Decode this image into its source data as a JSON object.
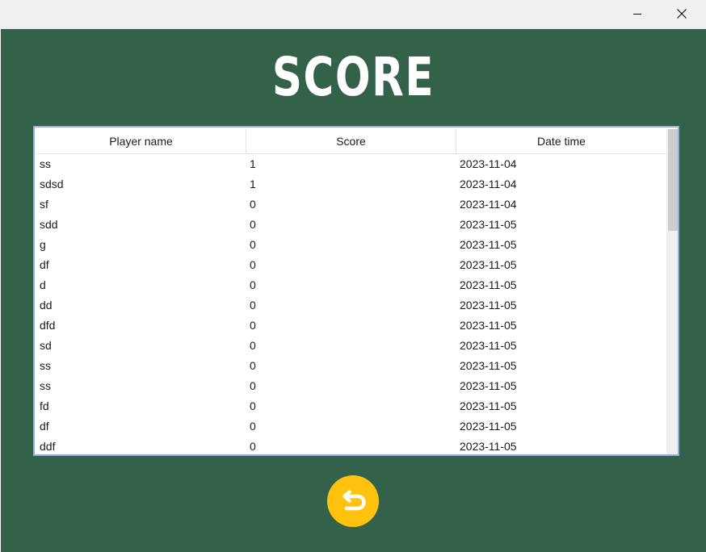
{
  "window": {
    "minimize_icon": "minimize-icon",
    "close_icon": "close-icon"
  },
  "page": {
    "title": "SCORE",
    "background_color": "#33614a",
    "accent_color": "#ffc20e"
  },
  "table": {
    "columns": [
      "Player name",
      "Score",
      "Date time"
    ],
    "rows": [
      [
        "ss",
        "1",
        "2023-11-04"
      ],
      [
        "sdsd",
        "1",
        "2023-11-04"
      ],
      [
        "sf",
        "0",
        "2023-11-04"
      ],
      [
        "sdd",
        "0",
        "2023-11-05"
      ],
      [
        "g",
        "0",
        "2023-11-05"
      ],
      [
        "df",
        "0",
        "2023-11-05"
      ],
      [
        "d",
        "0",
        "2023-11-05"
      ],
      [
        "dd",
        "0",
        "2023-11-05"
      ],
      [
        "dfd",
        "0",
        "2023-11-05"
      ],
      [
        "sd",
        "0",
        "2023-11-05"
      ],
      [
        "ss",
        "0",
        "2023-11-05"
      ],
      [
        "ss",
        "0",
        "2023-11-05"
      ],
      [
        "fd",
        "0",
        "2023-11-05"
      ],
      [
        "df",
        "0",
        "2023-11-05"
      ],
      [
        "ddf",
        "0",
        "2023-11-05"
      ]
    ]
  },
  "back_button": {
    "icon": "return-arrow-icon"
  }
}
